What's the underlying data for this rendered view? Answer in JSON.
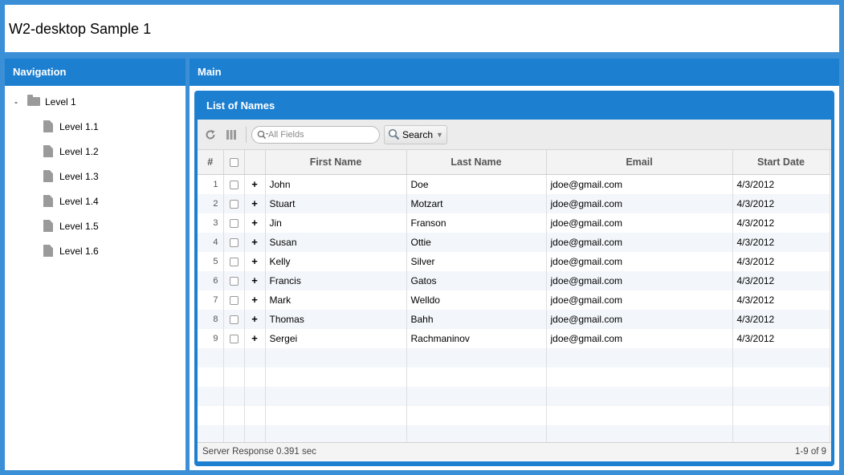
{
  "app": {
    "title": "W2-desktop Sample 1"
  },
  "navigation": {
    "header": "Navigation",
    "root": {
      "toggle": "-",
      "label": "Level 1"
    },
    "children": [
      "Level 1.1",
      "Level 1.2",
      "Level 1.3",
      "Level 1.4",
      "Level 1.5",
      "Level 1.6"
    ]
  },
  "main": {
    "header": "Main",
    "grid": {
      "header": "List of Names",
      "toolbar": {
        "reload_icon": "reload-icon",
        "columns_icon": "columns-icon",
        "search_placeholder": "All Fields",
        "search_label": "Search"
      },
      "columns": {
        "num": "#",
        "fname": "First Name",
        "lname": "Last Name",
        "email": "Email",
        "sdate": "Start Date"
      },
      "rows": [
        {
          "num": "1",
          "fname": "John",
          "lname": "Doe",
          "email": "jdoe@gmail.com",
          "sdate": "4/3/2012"
        },
        {
          "num": "2",
          "fname": "Stuart",
          "lname": "Motzart",
          "email": "jdoe@gmail.com",
          "sdate": "4/3/2012"
        },
        {
          "num": "3",
          "fname": "Jin",
          "lname": "Franson",
          "email": "jdoe@gmail.com",
          "sdate": "4/3/2012"
        },
        {
          "num": "4",
          "fname": "Susan",
          "lname": "Ottie",
          "email": "jdoe@gmail.com",
          "sdate": "4/3/2012"
        },
        {
          "num": "5",
          "fname": "Kelly",
          "lname": "Silver",
          "email": "jdoe@gmail.com",
          "sdate": "4/3/2012"
        },
        {
          "num": "6",
          "fname": "Francis",
          "lname": "Gatos",
          "email": "jdoe@gmail.com",
          "sdate": "4/3/2012"
        },
        {
          "num": "7",
          "fname": "Mark",
          "lname": "Welldo",
          "email": "jdoe@gmail.com",
          "sdate": "4/3/2012"
        },
        {
          "num": "8",
          "fname": "Thomas",
          "lname": "Bahh",
          "email": "jdoe@gmail.com",
          "sdate": "4/3/2012"
        },
        {
          "num": "9",
          "fname": "Sergei",
          "lname": "Rachmaninov",
          "email": "jdoe@gmail.com",
          "sdate": "4/3/2012"
        }
      ],
      "expand_symbol": "+",
      "footer": {
        "status": "Server Response 0.391 sec",
        "range": "1-9 of 9"
      }
    }
  }
}
